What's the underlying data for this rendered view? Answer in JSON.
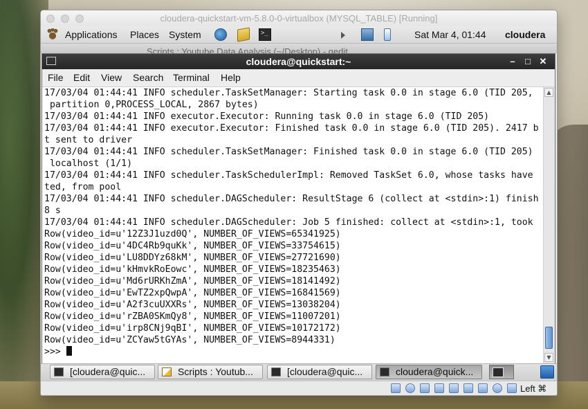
{
  "vbox": {
    "title": "cloudera-quickstart-vm-5.8.0-0-virtualbox (MYSQL_TABLE) [Running]",
    "host_key": "Left ⌘"
  },
  "gnome_panel": {
    "menus": [
      "Applications",
      "Places",
      "System"
    ],
    "clock": "Sat Mar  4, 01:44",
    "user": "cloudera"
  },
  "gedit_title": "Scripts : Youtube Data Analysis (~/Desktop) - gedit",
  "terminal": {
    "title": "cloudera@quickstart:~",
    "menu": [
      "File",
      "Edit",
      "View",
      "Search",
      "Terminal",
      "Help"
    ],
    "lines": [
      "17/03/04 01:44:41 INFO scheduler.TaskSetManager: Starting task 0.0 in stage 6.0 (TID 205,",
      " partition 0,PROCESS_LOCAL, 2867 bytes)",
      "17/03/04 01:44:41 INFO executor.Executor: Running task 0.0 in stage 6.0 (TID 205)",
      "17/03/04 01:44:41 INFO executor.Executor: Finished task 0.0 in stage 6.0 (TID 205). 2417 b",
      "t sent to driver",
      "17/03/04 01:44:41 INFO scheduler.TaskSetManager: Finished task 0.0 in stage 6.0 (TID 205)",
      " localhost (1/1)",
      "17/03/04 01:44:41 INFO scheduler.TaskSchedulerImpl: Removed TaskSet 6.0, whose tasks have",
      "ted, from pool",
      "17/03/04 01:44:41 INFO scheduler.DAGScheduler: ResultStage 6 (collect at <stdin>:1) finish",
      "8 s",
      "17/03/04 01:44:41 INFO scheduler.DAGScheduler: Job 5 finished: collect at <stdin>:1, took",
      "Row(video_id=u'12Z3J1uzd0Q', NUMBER_OF_VIEWS=65341925)",
      "Row(video_id=u'4DC4Rb9quKk', NUMBER_OF_VIEWS=33754615)",
      "Row(video_id=u'LU8DDYz68kM', NUMBER_OF_VIEWS=27721690)",
      "Row(video_id=u'kHmvkRoEowc', NUMBER_OF_VIEWS=18235463)",
      "Row(video_id=u'Md6rURKhZmA', NUMBER_OF_VIEWS=18141492)",
      "Row(video_id=u'EwTZ2xpQwpA', NUMBER_OF_VIEWS=16841569)",
      "Row(video_id=u'A2f3cuUXXRs', NUMBER_OF_VIEWS=13038204)",
      "Row(video_id=u'rZBA0SKmQy8', NUMBER_OF_VIEWS=11007201)",
      "Row(video_id=u'irp8CNj9qBI', NUMBER_OF_VIEWS=10172172)",
      "Row(video_id=u'ZCYaw5tGYAs', NUMBER_OF_VIEWS=8944331)"
    ],
    "prompt": ">>> "
  },
  "taskbar": {
    "tasks": [
      {
        "label": "[cloudera@quic...",
        "icon": "terminal-icon"
      },
      {
        "label": "Scripts : Youtub...",
        "icon": "gedit-icon"
      },
      {
        "label": "[cloudera@quic...",
        "icon": "terminal-icon"
      },
      {
        "label": "cloudera@quick...",
        "icon": "terminal-icon",
        "active": true
      }
    ]
  }
}
